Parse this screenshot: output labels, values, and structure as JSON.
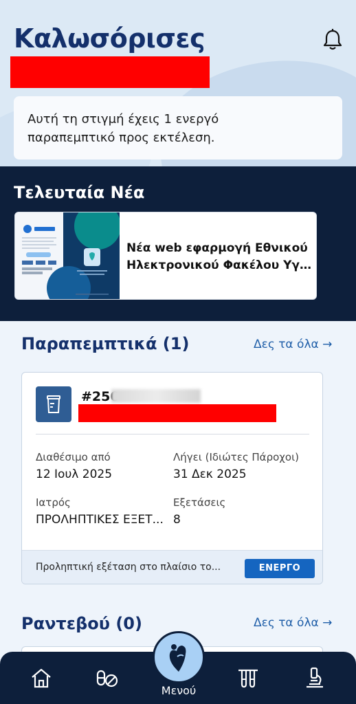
{
  "header": {
    "greeting": "Καλωσόρισες",
    "status_line1": "Αυτή τη στιγμή έχεις 1 ενεργό",
    "status_line2": "παραπεμπτικό προς εκτέλεση."
  },
  "news": {
    "title": "Τελευταία Νέα",
    "item_line1": "Νέα web εφαρμογή Εθνικού",
    "item_line2": "Ηλεκτρονικού Φακέλου Υγ..."
  },
  "referrals": {
    "title": "Παραπεμπτικά (1)",
    "see_all": "Δες τα όλα →",
    "card": {
      "number": "#250",
      "available_label": "Διαθέσιμο από",
      "available_value": "12 Ιουλ 2025",
      "expires_label": "Λήγει (Ιδιώτες Πάροχοι)",
      "expires_value": "31 Δεκ 2025",
      "doctor_label": "Ιατρός",
      "doctor_value": "ΠΡΟΛΗΠΤΙΚΕΣ ΕΞΕΤ...",
      "exams_label": "Εξετάσεις",
      "exams_value": "8",
      "footer_text": "Προληπτική εξέταση στο πλαίσιο το...",
      "status": "ΕΝΕΡΓΟ"
    }
  },
  "appointments": {
    "title": "Ραντεβού (0)",
    "see_all": "Δες τα όλα →"
  },
  "nav": {
    "menu_label": "Μενού",
    "items": [
      "home-icon",
      "pills-icon",
      "menu-heart-icon",
      "test-tubes-icon",
      "microscope-icon"
    ]
  },
  "colors": {
    "primary_dark": "#0d1f3b",
    "title_blue": "#14306b",
    "link_blue": "#1f5ea8",
    "badge_blue": "#1565c0",
    "fab_blue": "#a9d0f5"
  }
}
